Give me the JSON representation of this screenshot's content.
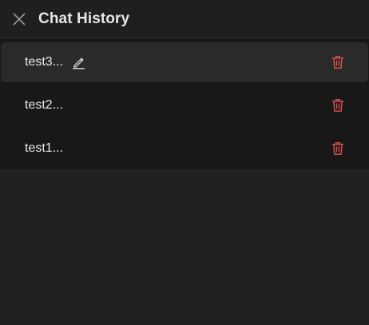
{
  "header": {
    "title": "Chat History",
    "close_icon": "close-icon"
  },
  "history": {
    "items": [
      {
        "label": "test3...",
        "active": true,
        "edit_icon": "pencil-icon",
        "delete_icon": "trash-icon"
      },
      {
        "label": "test2...",
        "active": false,
        "delete_icon": "trash-icon"
      },
      {
        "label": "test1...",
        "active": false,
        "delete_icon": "trash-icon"
      }
    ]
  },
  "colors": {
    "background": "#212121",
    "list_background": "#181818",
    "active_item": "#2a2a2a",
    "delete_icon": "#e05252",
    "text": "#e8e8e8"
  }
}
